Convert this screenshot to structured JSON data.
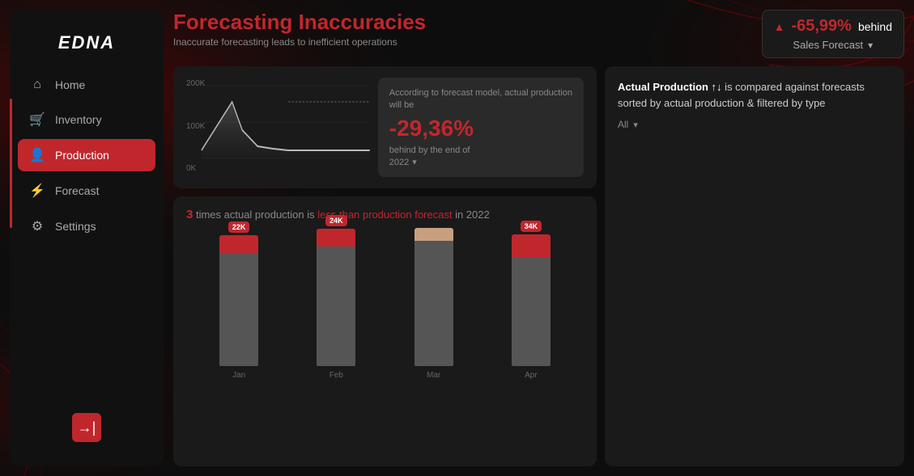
{
  "app": {
    "logo": "EDNA"
  },
  "sidebar": {
    "items": [
      {
        "id": "home",
        "label": "Home",
        "icon": "⌂",
        "active": false
      },
      {
        "id": "inventory",
        "label": "Inventory",
        "icon": "🛒",
        "active": false
      },
      {
        "id": "production",
        "label": "Production",
        "icon": "👤",
        "active": true
      },
      {
        "id": "forecast",
        "label": "Forecast",
        "icon": "⚡",
        "active": false
      },
      {
        "id": "settings",
        "label": "Settings",
        "icon": "⚙",
        "active": false
      }
    ],
    "logout_label": "→|"
  },
  "header": {
    "title_plain": "Forecasting ",
    "title_highlight": "Inaccuracies",
    "subtitle": "Inaccurate forecasting leads to inefficient operations",
    "badge": {
      "percent": "-65,99%",
      "behind": "behind",
      "label": "Sales Forecast"
    }
  },
  "line_chart": {
    "y_labels": [
      "200K",
      "100K",
      "0K"
    ],
    "info": {
      "text_before": "According to forecast model, actual production",
      "will_be": "will be",
      "percent": "-29,36%",
      "text_after": "behind by  the end of",
      "year": "2022"
    }
  },
  "bar_chart": {
    "title_num": "3",
    "title_text_before": " times actual production is ",
    "title_highlight": "less than production forecast",
    "title_text_after": " in 2022",
    "bars": [
      {
        "month": "Jan",
        "label": "22K",
        "top_height": 22,
        "main_height": 140,
        "top_color": "#c0272d"
      },
      {
        "month": "Feb",
        "label": "24K",
        "top_height": 22,
        "main_height": 148,
        "top_color": "#c0272d"
      },
      {
        "month": "Mar",
        "label": "",
        "top_height": 16,
        "main_height": 155,
        "top_color": "#c8a080"
      },
      {
        "month": "Apr",
        "label": "34K",
        "top_height": 28,
        "main_height": 135,
        "top_color": "#c0272d"
      }
    ]
  },
  "right_panel": {
    "text": "Actual Production ↑↓ is compared against forecasts sorted by actual production & filtered by type",
    "filter_label": "All"
  }
}
